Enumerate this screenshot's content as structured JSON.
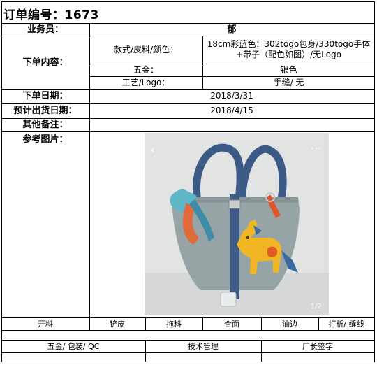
{
  "form": {
    "title": "订单编号：1673",
    "salesperson_label": "业务员：",
    "salesperson_value": "郁",
    "order_content_label": "下单内容：",
    "style_label": "款式/皮料/颜色：",
    "style_value": "18cm彩蓝色：302togo包身/330togo手体+带子（配色如图）/无Logo",
    "hardware_label": "五金：",
    "hardware_value": "银色",
    "craft_label": "工艺/Logo：",
    "craft_value": "手缝/ 无",
    "order_date_label": "下单日期：",
    "order_date_value": "2018/3/31",
    "ship_date_label": "预计出货日期：",
    "ship_date_value": "2018/4/15",
    "remarks_label": "其他备注：",
    "reference_label": "参考图片：",
    "photo_counter": "1/2",
    "photo_nav_left": "‹",
    "photo_menu": "···"
  },
  "process": {
    "steps": [
      "开料",
      "铲皮",
      "拖料",
      "合面",
      "油边",
      "打析/ 缝线"
    ],
    "sign_labels": [
      "五金/ 包装/ QC",
      "技术管理",
      "厂长签字"
    ]
  },
  "colors": {
    "bag_body": "#96a4a6",
    "handle": "#3c5a86",
    "charm": "#f0b624",
    "charm_mane": "#3a6aa0",
    "photo_bg": "#dfe1e1"
  }
}
